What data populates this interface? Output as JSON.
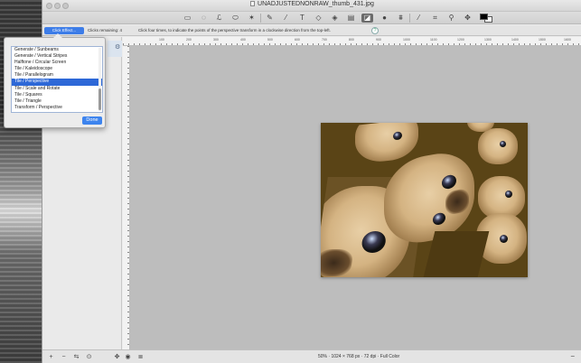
{
  "window": {
    "title": "UNADJUSTEDNONRAW_thumb_431.jpg"
  },
  "toolbar": {
    "tools": [
      {
        "name": "rect-select-icon",
        "glyph": "▭"
      },
      {
        "name": "ellipse-select-icon",
        "glyph": "◌"
      },
      {
        "name": "lasso-icon",
        "glyph": "ℒ"
      },
      {
        "name": "polygon-lasso-icon",
        "glyph": "⬭"
      },
      {
        "name": "magic-wand-icon",
        "glyph": "✶"
      },
      {
        "name": "pencil-icon",
        "glyph": "✎"
      },
      {
        "name": "brush-icon",
        "glyph": "⁄"
      },
      {
        "name": "text-icon",
        "glyph": "T"
      },
      {
        "name": "eraser-icon",
        "glyph": "◇"
      },
      {
        "name": "paint-bucket-icon",
        "glyph": "◈"
      },
      {
        "name": "gradient-icon",
        "glyph": "▤"
      },
      {
        "name": "effects-icon",
        "glyph": "◪"
      },
      {
        "name": "dropper-fill-icon",
        "glyph": "●"
      },
      {
        "name": "clone-stamp-icon",
        "glyph": "⩩"
      },
      {
        "name": "eyedropper-icon",
        "glyph": "⁄"
      },
      {
        "name": "crop-icon",
        "glyph": "⌗"
      },
      {
        "name": "zoom-icon",
        "glyph": "⚲"
      },
      {
        "name": "move-icon",
        "glyph": "✥"
      }
    ],
    "active_tool": "effects-icon",
    "foreground_color": "#000000",
    "background_color": "#ffffff"
  },
  "options": {
    "effect_button": "Click Effect...",
    "clicks_remaining": "Clicks remaining: 4",
    "instruction": "Click four times, to indicate the points of the perspective transform in a clockwise direction from the top-left.",
    "help": "?"
  },
  "ruler": {
    "top_labels": [
      "100",
      "200",
      "300",
      "400",
      "500",
      "600",
      "700",
      "800",
      "900",
      "1000",
      "1100",
      "1200",
      "1300",
      "1400",
      "1500",
      "1600"
    ]
  },
  "effect_popup": {
    "items": [
      "Generate / Sunbeams",
      "Generate / Vertical Stripes",
      "Halftone / Circular Screen",
      "Tile / Kaleidoscope",
      "Tile / Parallelogram",
      "Tile / Perspective",
      "Tile / Scale and Rotate",
      "Tile / Squares",
      "Tile / Triangle",
      "Transform / Perspective"
    ],
    "selected_index": 5,
    "done_label": "Done"
  },
  "statusbar": {
    "info": "50% · 1024 × 768 px · 72 dpi · Full Color",
    "zoom_out": "−",
    "buttons": [
      {
        "name": "add-layer-icon",
        "glyph": "+"
      },
      {
        "name": "remove-layer-icon",
        "glyph": "−"
      },
      {
        "name": "duplicate-layer-icon",
        "glyph": "⇆"
      },
      {
        "name": "layer-settings-icon",
        "glyph": "⊙"
      },
      {
        "name": "move-layer-icon",
        "glyph": "✥"
      },
      {
        "name": "visibility-icon",
        "glyph": "◉"
      },
      {
        "name": "layers-icon",
        "glyph": "≣"
      }
    ]
  }
}
